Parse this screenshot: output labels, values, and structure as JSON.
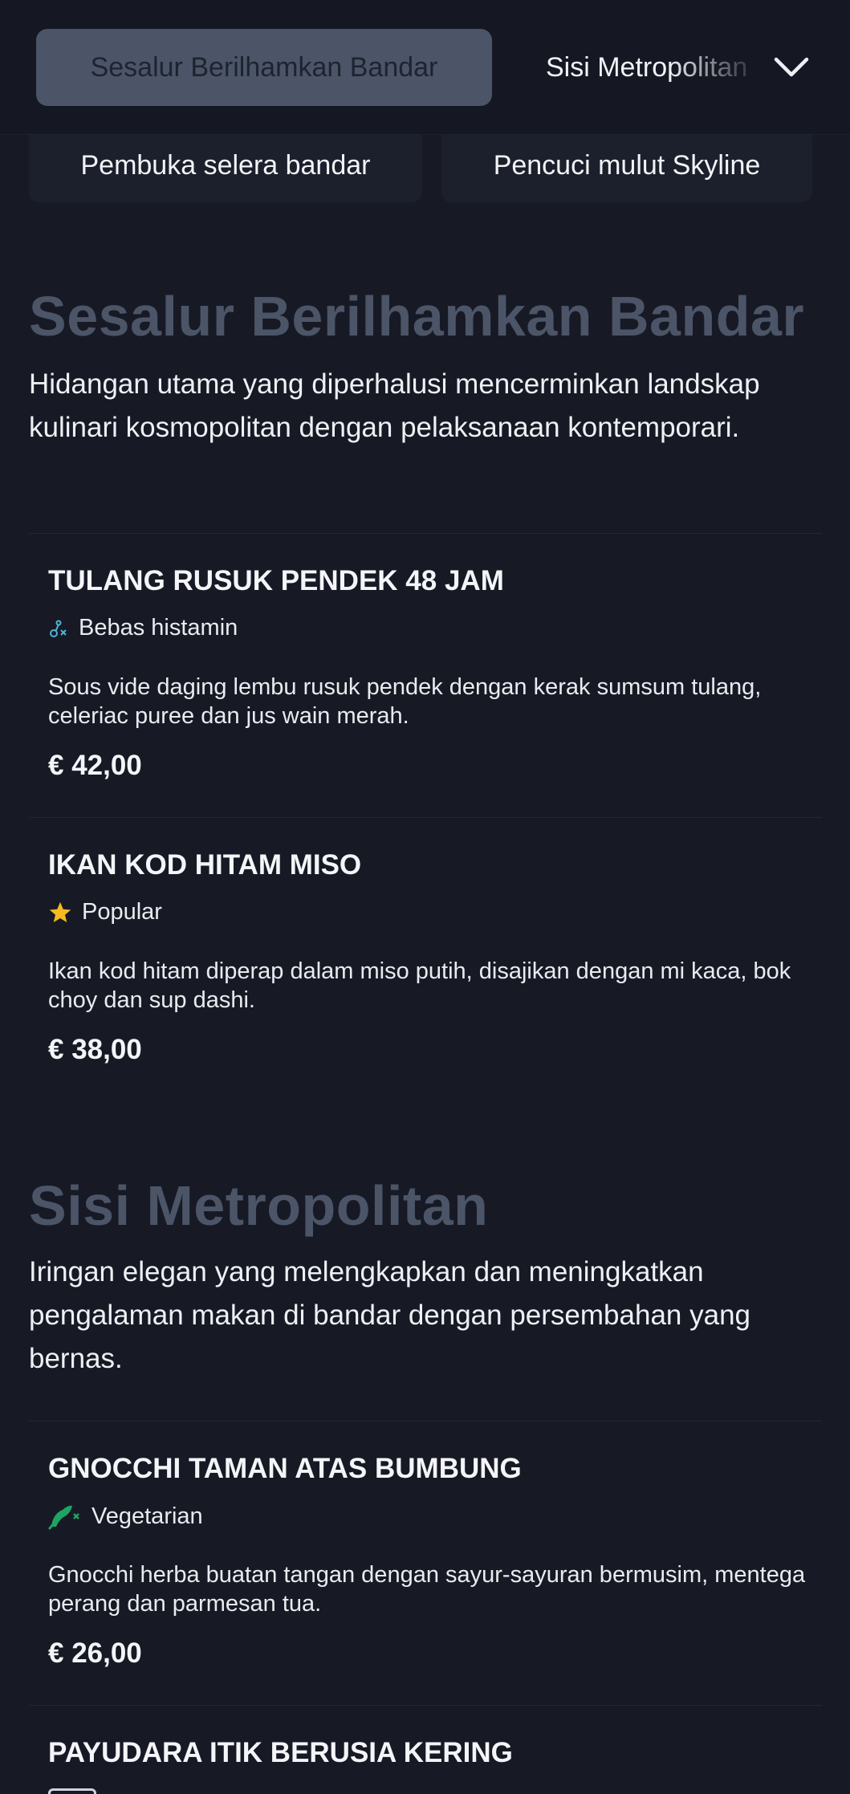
{
  "nav": {
    "active_category": "Sesalur Berilhamkan Bandar",
    "next_category": "Sisi Metropolitan",
    "pills": [
      "Pembuka selera bandar",
      "Pencuci mulut Skyline"
    ]
  },
  "sections": [
    {
      "title": "Sesalur Berilhamkan Bandar",
      "description": "Hidangan utama yang diperhalusi mencerminkan landskap kulinari kosmopolitan dengan pelaksanaan kontemporari.",
      "items": [
        {
          "name": "TULANG RUSUK PENDEK 48 JAM",
          "badge": "Bebas histamin",
          "badge_icon": "histamine-free-icon",
          "description": "Sous vide daging lembu rusuk pendek dengan kerak sumsum tulang, celeriac puree dan jus wain merah.",
          "price": "€ 42,00"
        },
        {
          "name": "IKAN KOD HITAM MISO",
          "badge": "Popular",
          "badge_icon": "star-icon",
          "description": "Ikan kod hitam diperap dalam miso putih, disajikan dengan mi kaca, bok choy dan sup dashi.",
          "price": "€ 38,00"
        }
      ]
    },
    {
      "title": "Sisi Metropolitan",
      "description": "Iringan elegan yang melengkapkan dan meningkatkan pengalaman makan di bandar dengan persembahan yang bernas.",
      "items": [
        {
          "name": "GNOCCHI TAMAN ATAS BUMBUNG",
          "badge": "Vegetarian",
          "badge_icon": "vegetarian-icon",
          "description": "Gnocchi herba buatan tangan dengan sayur-sayuran bermusim, mentega perang dan parmesan tua.",
          "price": "€ 26,00"
        },
        {
          "name": "PAYUDARA ITIK BERUSIA KERING"
        }
      ]
    }
  ],
  "colors": {
    "background": "#171a25",
    "active_pill": "#4b5567",
    "section_title": "#4b5567",
    "star": "#f5b921",
    "vegetarian": "#1fa463",
    "histamine": "#4fb3d9"
  }
}
